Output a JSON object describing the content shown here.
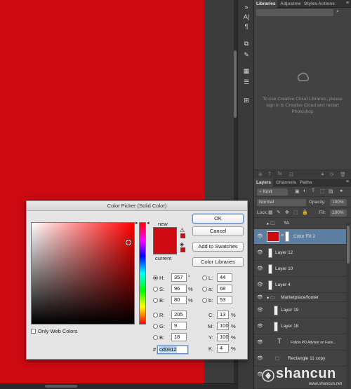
{
  "colors": {
    "fill": "#cd0912",
    "selected_row": "#5c7ea1",
    "panel_bg": "#424242"
  },
  "toolstrip": {
    "icons": [
      "type-icon",
      "paragraph-icon",
      "clone-icon",
      "brush-icon",
      "swatches-icon",
      "notes-icon",
      "properties-icon"
    ]
  },
  "libraries": {
    "tabs": [
      "Libraries",
      "Adjustme",
      "Styles",
      "Actions"
    ],
    "message": "To use Creative Cloud Libraries, please sign in to Creative Cloud and restart Photoshop"
  },
  "layers_panel": {
    "tabs": [
      "Layers",
      "Channels",
      "Paths"
    ],
    "filter": "Kind",
    "blend_mode": "Normal",
    "opacity_label": "Opacity:",
    "opacity_value": "100%",
    "lock_label": "Lock:",
    "fill_label": "Fill:",
    "fill_value": "100%",
    "layers": [
      {
        "name": "TA",
        "type": "group",
        "visible": false
      },
      {
        "name": "Color Fill 2",
        "type": "fill",
        "visible": true,
        "selected": true
      },
      {
        "name": "Layer 12",
        "type": "layer",
        "visible": true
      },
      {
        "name": "Layer 10",
        "type": "layer",
        "visible": true
      },
      {
        "name": "Layer 4",
        "type": "layer",
        "visible": true
      },
      {
        "name": "Marketplace/footer",
        "type": "group",
        "visible": true
      },
      {
        "name": "Layer 19",
        "type": "layer",
        "visible": true
      },
      {
        "name": "Layer 18",
        "type": "layer",
        "visible": true
      },
      {
        "name": "Follow PO Advisor on Face...",
        "type": "text",
        "visible": true
      },
      {
        "name": "Rectangle 11 copy",
        "type": "shape",
        "visible": true
      }
    ]
  },
  "color_picker": {
    "title": "Color Picker (Solid Color)",
    "new_label": "new",
    "current_label": "current",
    "buttons": {
      "ok": "OK",
      "cancel": "Cancel",
      "add_swatches": "Add to Swatches",
      "color_libraries": "Color Libraries"
    },
    "only_web_colors": "Only Web Colors",
    "fields": {
      "H": {
        "value": "357",
        "unit": "°"
      },
      "S": {
        "value": "96",
        "unit": "%"
      },
      "B": {
        "value": "80",
        "unit": "%"
      },
      "R": {
        "value": "205",
        "unit": ""
      },
      "G": {
        "value": "9",
        "unit": ""
      },
      "Bb": {
        "value": "18",
        "unit": ""
      },
      "L": {
        "value": "44",
        "unit": ""
      },
      "a": {
        "value": "68",
        "unit": ""
      },
      "b": {
        "value": "53",
        "unit": ""
      },
      "C": {
        "value": "13",
        "unit": "%"
      },
      "M": {
        "value": "100",
        "unit": "%"
      },
      "Y": {
        "value": "100",
        "unit": "%"
      },
      "K": {
        "value": "4",
        "unit": "%"
      }
    },
    "labels": {
      "H": "H:",
      "S": "S:",
      "B": "B:",
      "R": "R:",
      "G": "G:",
      "Bb": "B:",
      "L": "L:",
      "a": "a:",
      "b": "b:",
      "C": "C:",
      "M": "M:",
      "Y": "Y:",
      "K": "K:"
    },
    "hex_prefix": "#",
    "hex_value": "cd0912"
  },
  "watermark": {
    "text": "shancun",
    "domain": "www.shancun.net"
  }
}
